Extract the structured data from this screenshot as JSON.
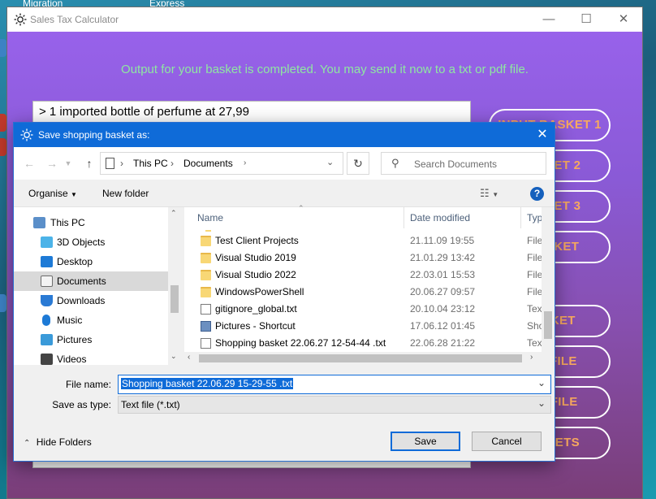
{
  "desktop": {
    "labels": [
      "Migration",
      "Express"
    ]
  },
  "app": {
    "title": "Sales Tax Calculator",
    "status_message": "Output for your basket is completed. You may send it now to a txt or pdf file.",
    "output_first_line": "> 1 imported bottle of perfume at 27,99",
    "side_buttons": [
      "INPUT BASKET 1",
      "BASKET 2",
      "BASKET 3",
      "/ BASKET",
      "BASKET",
      "TXT FILE",
      "PDF FILE",
      "BASKETS"
    ],
    "accent_text_color": "#f7a95f",
    "status_color": "#8fe6a2"
  },
  "dialog": {
    "title": "Save shopping basket as:",
    "breadcrumb": [
      "This PC",
      "Documents"
    ],
    "search_placeholder": "Search Documents",
    "toolbar": {
      "organise": "Organise",
      "new_folder": "New folder"
    },
    "nav_tree": [
      {
        "label": "This PC",
        "icon": "pc-icon"
      },
      {
        "label": "3D Objects",
        "icon": "cube-icon"
      },
      {
        "label": "Desktop",
        "icon": "desktop-icon"
      },
      {
        "label": "Documents",
        "icon": "documents-icon",
        "selected": true
      },
      {
        "label": "Downloads",
        "icon": "download-icon"
      },
      {
        "label": "Music",
        "icon": "music-icon"
      },
      {
        "label": "Pictures",
        "icon": "pictures-icon"
      },
      {
        "label": "Videos",
        "icon": "videos-icon"
      }
    ],
    "columns": {
      "name": "Name",
      "date": "Date modified",
      "type": "Typ"
    },
    "files": [
      {
        "name": "Test Client Projects",
        "date": "21.11.09 19:55",
        "type": "File",
        "kind": "folder"
      },
      {
        "name": "Visual Studio 2019",
        "date": "21.01.29 13:42",
        "type": "File",
        "kind": "folder"
      },
      {
        "name": "Visual Studio 2022",
        "date": "22.03.01 15:53",
        "type": "File",
        "kind": "folder"
      },
      {
        "name": "WindowsPowerShell",
        "date": "20.06.27 09:57",
        "type": "File",
        "kind": "folder"
      },
      {
        "name": "gitignore_global.txt",
        "date": "20.10.04 23:12",
        "type": "Text",
        "kind": "txt"
      },
      {
        "name": "Pictures - Shortcut",
        "date": "17.06.12 01:45",
        "type": "Sho",
        "kind": "link"
      },
      {
        "name": "Shopping basket 22.06.27 12-54-44 .txt",
        "date": "22.06.28 21:22",
        "type": "Text",
        "kind": "txt"
      }
    ],
    "file_name_label": "File name:",
    "file_name_value": "Shopping basket 22.06.29 15-29-55 .txt",
    "save_as_type_label": "Save as type:",
    "save_as_type_value": "Text file (*.txt)",
    "hide_folders": "Hide Folders",
    "save": "Save",
    "cancel": "Cancel"
  }
}
